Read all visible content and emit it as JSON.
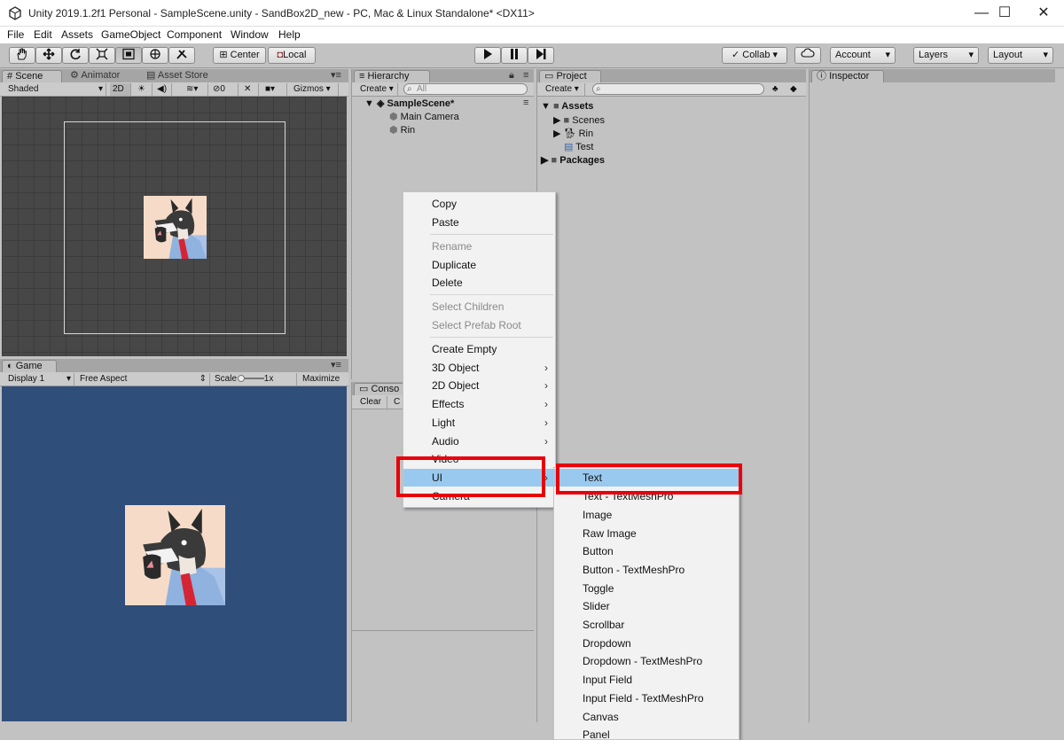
{
  "window": {
    "title": "Unity 2019.1.2f1 Personal - SampleScene.unity - SandBox2D_new - PC, Mac & Linux Standalone* <DX11>",
    "minimize": "—",
    "maximize": "☐",
    "close": "✕"
  },
  "menubar": [
    "File",
    "Edit",
    "Assets",
    "GameObject",
    "Component",
    "Window",
    "Help"
  ],
  "toolbar": {
    "pivot": "Center",
    "space": "Local",
    "collab": "Collab ▾",
    "account": "Account",
    "layers": "Layers",
    "layout": "Layout"
  },
  "scene_panel": {
    "tabs": [
      "Scene",
      "Animator",
      "Asset Store"
    ],
    "shading": "Shaded",
    "mode_2d": "2D",
    "effects_count": "0",
    "gizmos": "Gizmos"
  },
  "game_panel": {
    "tab": "Game",
    "display": "Display 1",
    "aspect": "Free Aspect",
    "scale_label": "Scale",
    "scale_value": "1x",
    "maximize": "Maximize"
  },
  "hierarchy": {
    "tab": "Hierarchy",
    "create": "Create",
    "search_placeholder": "All",
    "scene": "SampleScene*",
    "items": [
      "Main Camera",
      "Rin"
    ]
  },
  "console": {
    "tab": "Conso",
    "clear": "Clear",
    "collapse": "C"
  },
  "project": {
    "tab": "Project",
    "create": "Create",
    "tree": {
      "assets": "Assets",
      "scenes": "Scenes",
      "rin": "Rin",
      "test": "Test",
      "packages": "Packages"
    }
  },
  "inspector": {
    "tab": "Inspector"
  },
  "context_menu": {
    "items": [
      "Copy",
      "Paste",
      "Rename",
      "Duplicate",
      "Delete",
      "Select Children",
      "Select Prefab Root",
      "Create Empty",
      "3D Object",
      "2D Object",
      "Effects",
      "Light",
      "Audio",
      "Video",
      "UI",
      "Camera"
    ]
  },
  "ui_submenu": {
    "items": [
      "Text",
      "Text - TextMeshPro",
      "Image",
      "Raw Image",
      "Button",
      "Button - TextMeshPro",
      "Toggle",
      "Slider",
      "Scrollbar",
      "Dropdown",
      "Dropdown - TextMeshPro",
      "Input Field",
      "Input Field - TextMeshPro",
      "Canvas",
      "Panel"
    ]
  },
  "colors": {
    "highlight": "#99c9ef",
    "annotation": "#e8000b",
    "game_bg": "#304e7a"
  }
}
